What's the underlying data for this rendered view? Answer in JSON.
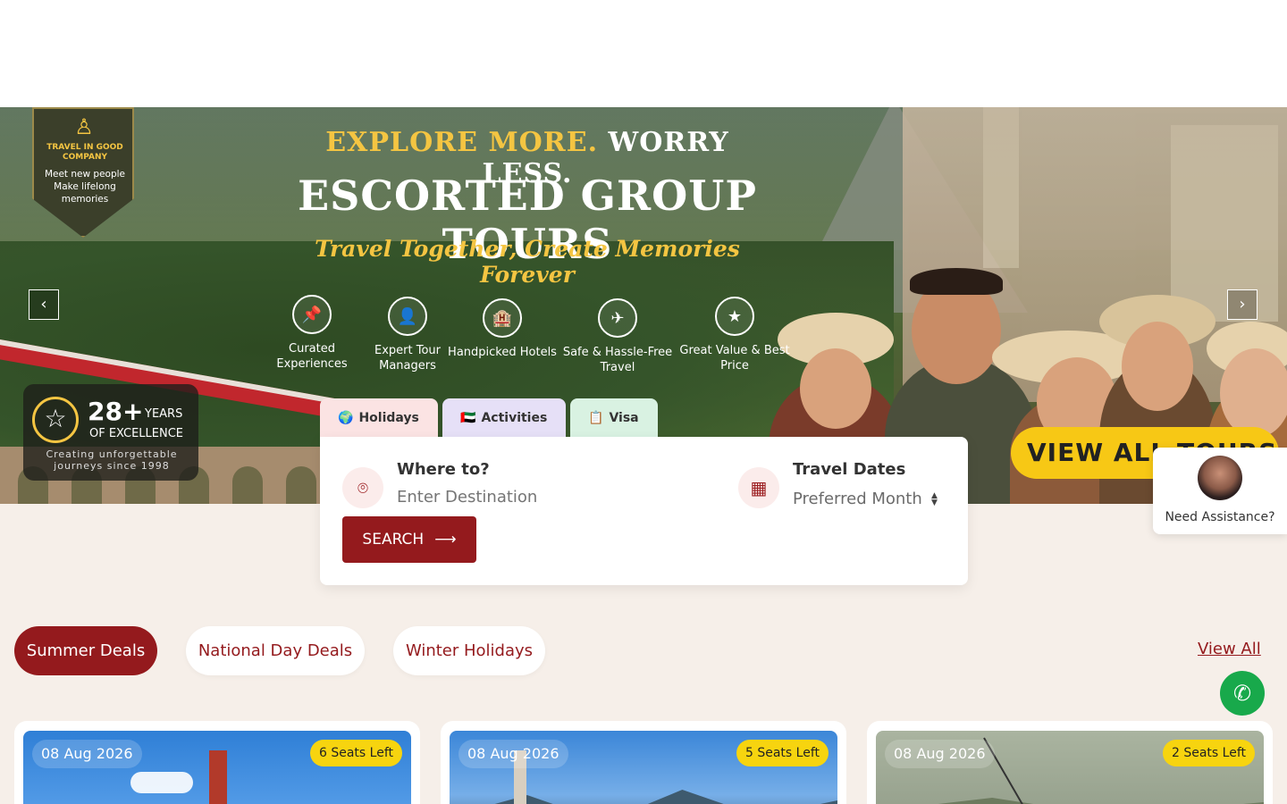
{
  "hero": {
    "badge_title": "TRAVEL IN GOOD COMPANY",
    "badge_subtitle": "Meet new people Make lifelong memories",
    "headline_gold": "EXPLORE MORE.",
    "headline_white": "WORRY LESS.",
    "title": "ESCORTED GROUP TOURS",
    "tagline": "Travel Together, Create Memories Forever",
    "features": [
      {
        "icon": "pin-icon",
        "label": "Curated Experiences"
      },
      {
        "icon": "tour-manager-icon",
        "label": "Expert Tour Managers"
      },
      {
        "icon": "hotel-icon",
        "label": "Handpicked Hotels"
      },
      {
        "icon": "plane-check-icon",
        "label": "Safe & Hassle-Free Travel"
      },
      {
        "icon": "award-icon",
        "label": "Great Value & Best Price"
      }
    ],
    "years_number": "28+",
    "years_label": "YEARS",
    "years_excellence": "OF EXCELLENCE",
    "years_since": "Creating unforgettable journeys since 1998",
    "view_all_tours": "VIEW ALL TOURS",
    "prev_arrow": "‹",
    "next_arrow": "›"
  },
  "search": {
    "tabs": [
      {
        "label": "Holidays",
        "icon": "globe-icon"
      },
      {
        "label": "Activities",
        "icon": "uae-flag-icon"
      },
      {
        "label": "Visa",
        "icon": "document-icon"
      }
    ],
    "destination_label": "Where to?",
    "destination_placeholder": "Enter Destination",
    "dates_label": "Travel Dates",
    "dates_value": "Preferred Month",
    "search_button": "SEARCH"
  },
  "assistance": {
    "label": "Need Assistance?"
  },
  "deals": {
    "pills": [
      "Summer Deals",
      "National Day Deals",
      "Winter Holidays"
    ],
    "active_index": 0,
    "view_all": "View All"
  },
  "cards": [
    {
      "date": "08 Aug 2026",
      "seats": "6 Seats Left"
    },
    {
      "date": "08 Aug 2026",
      "seats": "5 Seats Left"
    },
    {
      "date": "08 Aug 2026",
      "seats": "2 Seats Left"
    }
  ],
  "colors": {
    "brand": "#941a1d",
    "gold": "#f4c542",
    "seats_badge": "#f7d40f",
    "whatsapp": "#18a94b",
    "page_bg": "#f6efe9"
  }
}
